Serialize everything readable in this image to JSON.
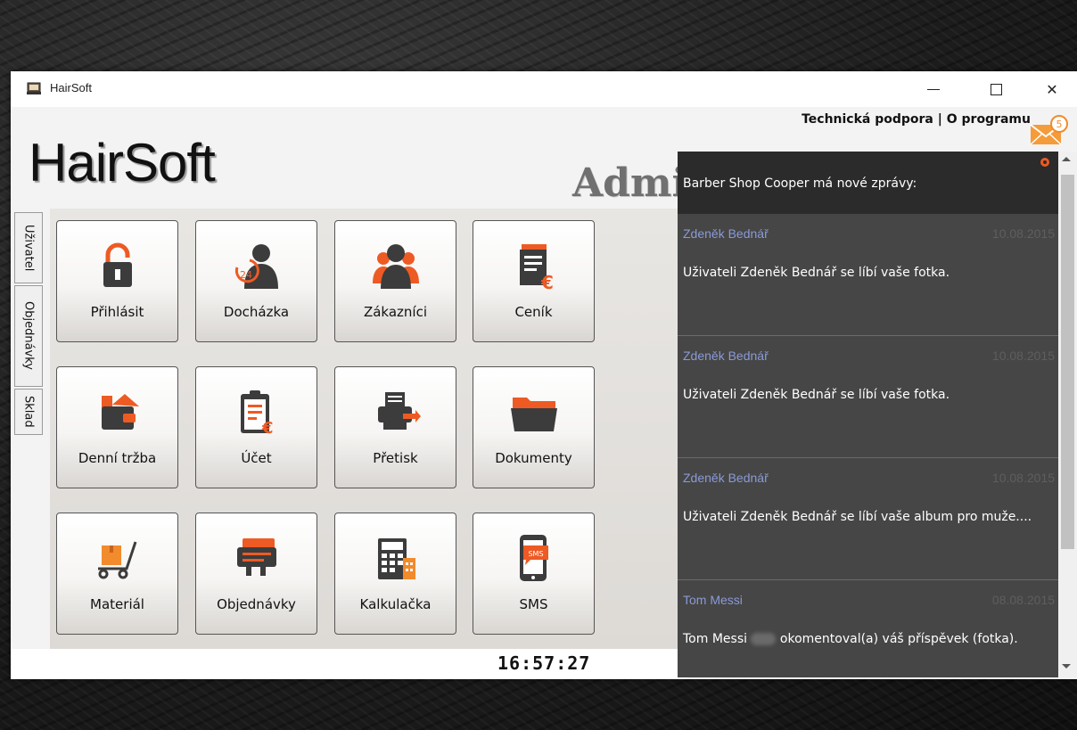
{
  "window": {
    "title": "HairSoft"
  },
  "header": {
    "support_links": "Technická podpora | O programu",
    "mail_count": "5",
    "brand": "HairSoft",
    "role_partial": "Admi"
  },
  "side_tabs": [
    {
      "label": "Uživatel"
    },
    {
      "label": "Objednávky"
    },
    {
      "label": "Sklad"
    }
  ],
  "tiles": [
    {
      "label": "Přihlásit",
      "icon": "lock-icon"
    },
    {
      "label": "Docházka",
      "icon": "attendance-icon"
    },
    {
      "label": "Zákazníci",
      "icon": "customers-icon"
    },
    {
      "label": "Ceník",
      "icon": "pricelist-icon"
    },
    {
      "label": "Denní tržba",
      "icon": "wallet-icon"
    },
    {
      "label": "Účet",
      "icon": "bill-icon"
    },
    {
      "label": "Přetisk",
      "icon": "printer-icon"
    },
    {
      "label": "Dokumenty",
      "icon": "folder-icon"
    },
    {
      "label": "Materiál",
      "icon": "cart-icon"
    },
    {
      "label": "Objednávky",
      "icon": "orders-icon"
    },
    {
      "label": "Kalkulačka",
      "icon": "calculator-icon"
    },
    {
      "label": "SMS",
      "icon": "sms-phone-icon"
    }
  ],
  "status": {
    "clock": "16:57:27"
  },
  "notifications": {
    "header": "Barber Shop Cooper má nové zprávy:",
    "messages": [
      {
        "author": "Zdeněk Bednář",
        "date": "10.08.2015",
        "text": "Uživateli Zdeněk Bednář se líbí vaše fotka."
      },
      {
        "author": "Zdeněk Bednář",
        "date": "10.08.2015",
        "text": "Uživateli Zdeněk Bednář se líbí vaše fotka."
      },
      {
        "author": "Zdeněk Bednář",
        "date": "10.08.2015",
        "text": "Uživateli Zdeněk Bednář se líbí vaše album pro muže...."
      },
      {
        "author": "Tom Messi",
        "date": "08.08.2015",
        "text_before": "Tom Messi",
        "text_after": "okomentoval(a) váš příspěvek (fotka)."
      }
    ]
  },
  "colors": {
    "accent": "#ee5a24",
    "dark_icon": "#3c3c3c",
    "panel_bg": "#464646",
    "panel_head": "#2b2b2b",
    "author": "#8a9ad6"
  }
}
